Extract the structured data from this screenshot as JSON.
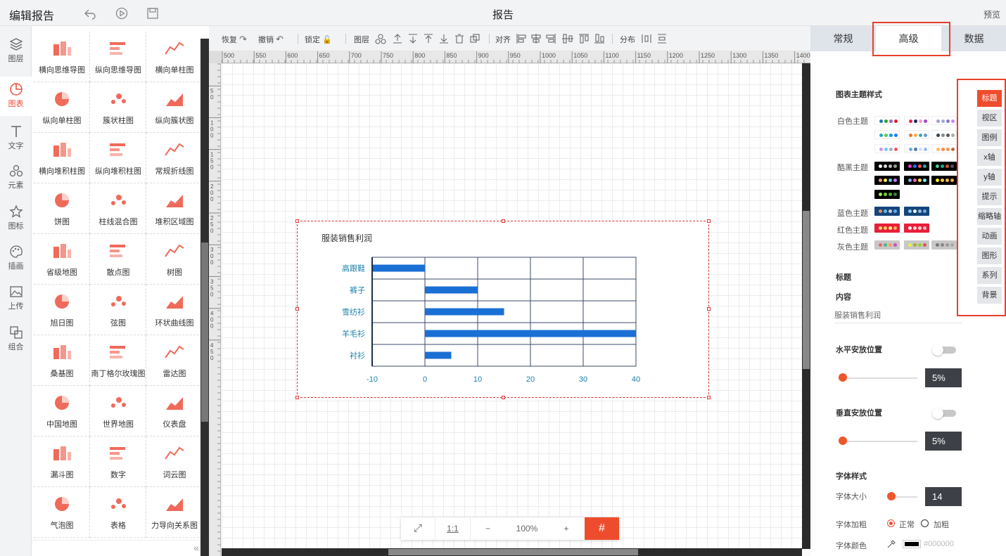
{
  "header": {
    "app_title": "编辑报告",
    "center_title": "报告",
    "preview_label": "预览"
  },
  "left_nav": [
    {
      "label": "图层",
      "icon": "layers-icon"
    },
    {
      "label": "图表",
      "icon": "chart-icon"
    },
    {
      "label": "文字",
      "icon": "text-icon"
    },
    {
      "label": "元素",
      "icon": "elements-icon"
    },
    {
      "label": "图标",
      "icon": "star-icon"
    },
    {
      "label": "插画",
      "icon": "palette-icon"
    },
    {
      "label": "上传",
      "icon": "upload-image-icon"
    },
    {
      "label": "组合",
      "icon": "group-icon"
    }
  ],
  "palette_items": [
    "横向思维导图",
    "纵向思维导图",
    "横向单柱图",
    "纵向单柱图",
    "簇状柱图",
    "纵向簇状图",
    "横向堆积柱图",
    "纵向堆积柱图",
    "常规折线图",
    "饼图",
    "柱线混合图",
    "堆积区域图",
    "省级地图",
    "散点图",
    "树图",
    "旭日图",
    "弦图",
    "环状曲线图",
    "桑基图",
    "南丁格尔玫瑰图",
    "雷达图",
    "中国地图",
    "世界地图",
    "仪表盘",
    "漏斗图",
    "数字",
    "词云图",
    "气泡图",
    "表格",
    "力导向关系图"
  ],
  "toolbar": {
    "restore": "恢复",
    "undo": "撤销",
    "lock": "锁定",
    "layer": "图层",
    "align": "对齐",
    "distribute": "分布"
  },
  "ruler_labels": [
    "500",
    "550",
    "600",
    "650",
    "700",
    "750",
    "800",
    "850",
    "900",
    "950",
    "1000",
    "1050",
    "1100",
    "1150",
    "1200",
    "1250",
    "1300",
    "1350",
    "1400"
  ],
  "ruler_v_labels": [
    "0",
    "5 0",
    "1 0 0",
    "1 5 0",
    "2 0 0",
    "2 5 0",
    "3 0 0",
    "3 5 0",
    "4 0 0",
    "4 5 0"
  ],
  "zoom": {
    "fit": "⤢",
    "one_to_one": "1:1",
    "minus": "−",
    "level": "100%",
    "plus": "+"
  },
  "right_panel": {
    "tabs": [
      "常规",
      "高级",
      "数据"
    ],
    "active_tab": "高级",
    "theme_section": "图表主题样式",
    "theme_groups": [
      "白色主题",
      "酷黑主题",
      "蓝色主题",
      "红色主题",
      "灰色主题"
    ],
    "title_label": "标题",
    "content_label": "内容",
    "content_value": "服装销售利润",
    "h_pos_label": "水平安放位置",
    "h_pos_value": "5%",
    "v_pos_label": "垂直安放位置",
    "v_pos_value": "5%",
    "font_section": "字体样式",
    "font_size_label": "字体大小",
    "font_size_value": "14",
    "font_bold_label": "字体加粗",
    "bold_normal": "正常",
    "bold_bold": "加粗",
    "font_color_label": "字体颜色",
    "font_color_value": "#000000",
    "side_tabs": [
      "标题",
      "视区",
      "图例",
      "x轴",
      "y轴",
      "提示",
      "缩略轴",
      "动画",
      "图形",
      "系列",
      "背景"
    ]
  },
  "chart_data": {
    "type": "bar",
    "orientation": "horizontal",
    "title": "服装销售利润",
    "categories": [
      "高跟鞋",
      "裤子",
      "雪纺衫",
      "羊毛衫",
      "衬衫"
    ],
    "values": [
      -10,
      10,
      15,
      40,
      5
    ],
    "xlim": [
      -10,
      40
    ],
    "xticks": [
      "-10",
      "0",
      "10",
      "20",
      "30",
      "40"
    ],
    "color": "#1a6fd4",
    "grid": true
  }
}
